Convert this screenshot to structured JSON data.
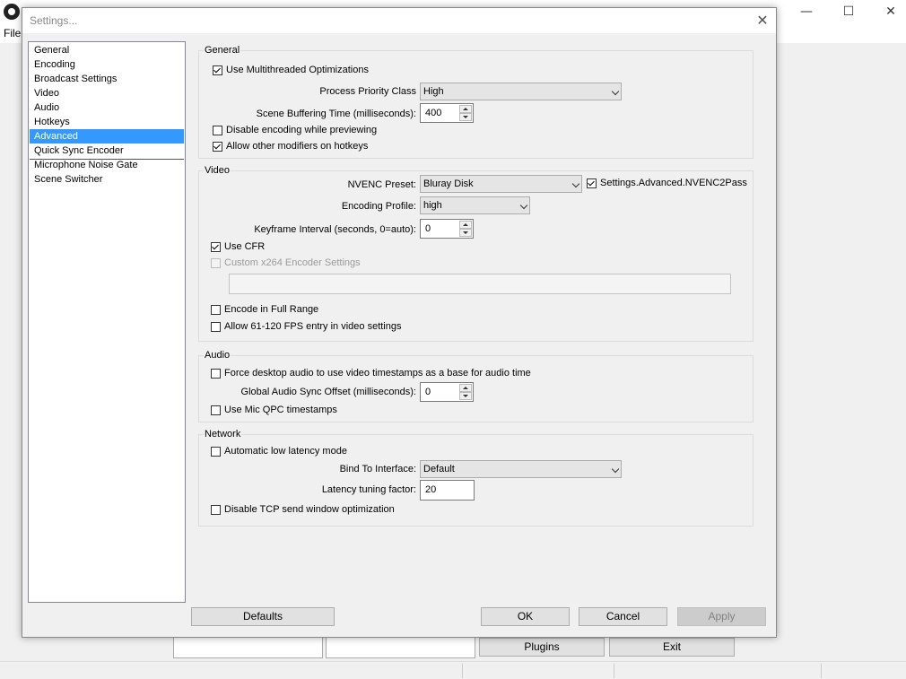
{
  "background_window": {
    "menu": {
      "file_label": "File"
    },
    "window_controls": {
      "minimize": "—",
      "maximize": "☐",
      "close": "✕"
    },
    "buttons": {
      "plugins": "Plugins",
      "exit": "Exit"
    }
  },
  "dialog": {
    "title": "Settings...",
    "close_glyph": "✕",
    "sidebar": {
      "items": [
        {
          "label": "General"
        },
        {
          "label": "Encoding"
        },
        {
          "label": "Broadcast Settings"
        },
        {
          "label": "Video"
        },
        {
          "label": "Audio"
        },
        {
          "label": "Hotkeys"
        },
        {
          "label": "Advanced",
          "selected": true
        },
        {
          "label": "Quick Sync Encoder"
        },
        {
          "label": "Microphone Noise Gate"
        },
        {
          "label": "Scene Switcher"
        }
      ]
    },
    "general": {
      "title": "General",
      "multithreaded": {
        "label": "Use Multithreaded Optimizations",
        "checked": true
      },
      "priority": {
        "label": "Process Priority Class",
        "value": "High"
      },
      "buffering": {
        "label": "Scene Buffering Time (milliseconds):",
        "value": "400"
      },
      "disable_preview": {
        "label": "Disable encoding while previewing",
        "checked": false
      },
      "modifiers": {
        "label": "Allow other modifiers on hotkeys",
        "checked": true
      }
    },
    "video": {
      "title": "Video",
      "nvenc_preset": {
        "label": "NVENC Preset:",
        "value": "Bluray Disk"
      },
      "nvenc2pass": {
        "label": "Settings.Advanced.NVENC2Pass",
        "checked": true
      },
      "encoding_profile": {
        "label": "Encoding Profile:",
        "value": "high"
      },
      "keyframe": {
        "label": "Keyframe Interval (seconds, 0=auto):",
        "value": "0"
      },
      "use_cfr": {
        "label": "Use CFR",
        "checked": true
      },
      "custom_x264": {
        "label": "Custom x264 Encoder Settings",
        "checked": false,
        "disabled": true,
        "value": ""
      },
      "full_range": {
        "label": "Encode in Full Range",
        "checked": false
      },
      "fps_entry": {
        "label": "Allow 61-120 FPS entry in video settings",
        "checked": false
      }
    },
    "audio": {
      "title": "Audio",
      "force_desktop": {
        "label": "Force desktop audio to use video timestamps as a base for audio time",
        "checked": false
      },
      "sync_offset": {
        "label": "Global Audio Sync Offset (milliseconds):",
        "value": "0"
      },
      "mic_qpc": {
        "label": "Use Mic QPC timestamps",
        "checked": false
      }
    },
    "network": {
      "title": "Network",
      "low_latency": {
        "label": "Automatic low latency mode",
        "checked": false
      },
      "bind_interface": {
        "label": "Bind To Interface:",
        "value": "Default"
      },
      "latency_factor": {
        "label": "Latency tuning factor:",
        "value": "20"
      },
      "disable_tcp": {
        "label": "Disable TCP send window optimization",
        "checked": false
      }
    },
    "buttons": {
      "defaults": "Defaults",
      "ok": "OK",
      "cancel": "Cancel",
      "apply": "Apply"
    }
  }
}
